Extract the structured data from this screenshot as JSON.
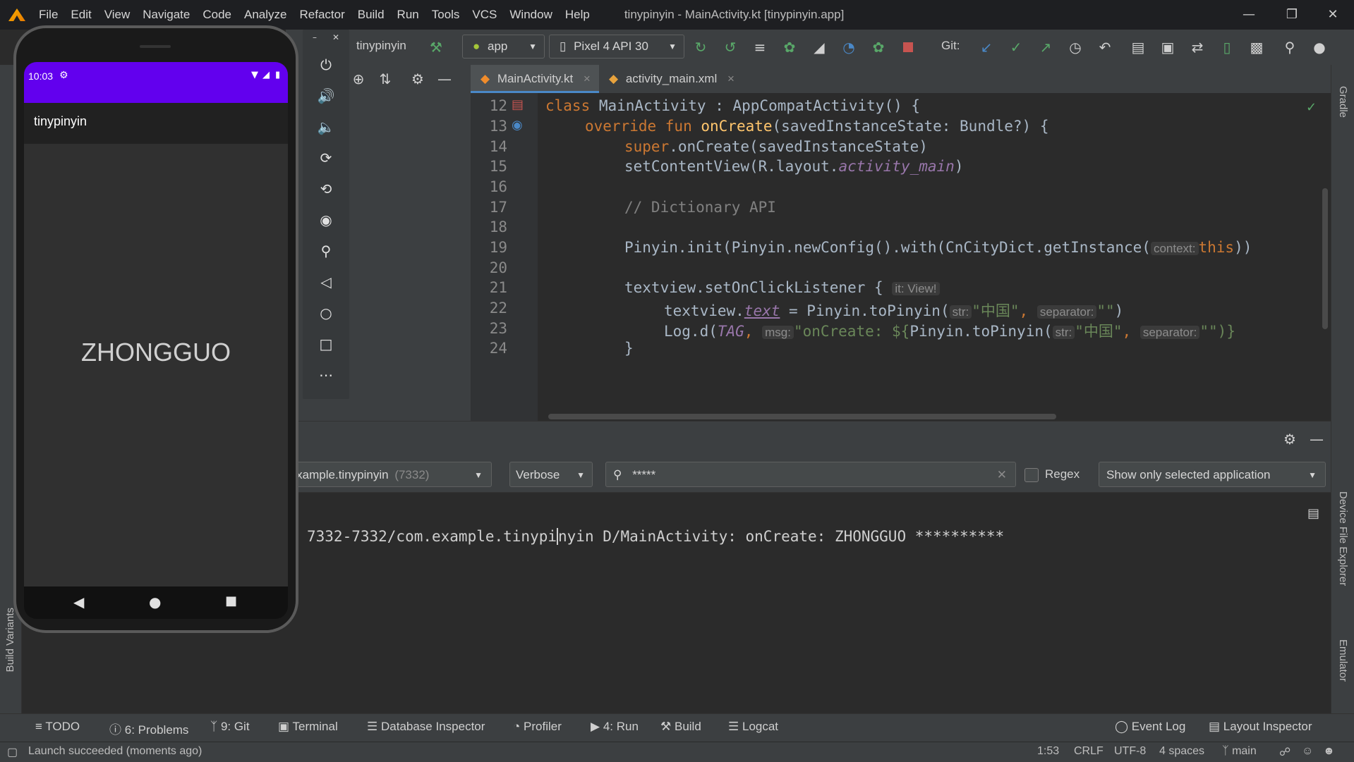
{
  "window": {
    "title": "tinypinyin - MainActivity.kt [tinypinyin.app]",
    "menus": [
      "File",
      "Edit",
      "View",
      "Navigate",
      "Code",
      "Analyze",
      "Refactor",
      "Build",
      "Run",
      "Tools",
      "VCS",
      "Window",
      "Help"
    ]
  },
  "toolbar": {
    "project": "tinypinyin",
    "run_config": "app",
    "device": "Pixel 4 API 30",
    "git_label": "Git:"
  },
  "tabs": [
    {
      "label": "MainActivity.kt",
      "active": true
    },
    {
      "label": "activity_main.xml",
      "active": false
    }
  ],
  "editor": {
    "lines": [
      {
        "n": "12"
      },
      {
        "n": "13"
      },
      {
        "n": "14"
      },
      {
        "n": "15"
      },
      {
        "n": "16"
      },
      {
        "n": "17"
      },
      {
        "n": "18"
      },
      {
        "n": "19"
      },
      {
        "n": "20"
      },
      {
        "n": "21"
      },
      {
        "n": "22"
      },
      {
        "n": "23"
      },
      {
        "n": "24"
      }
    ],
    "code": {
      "l12_kw": "class",
      "l12_rest": " MainActivity : AppCompatActivity() {",
      "l13_kw": "override fun",
      "l13_fn": "onCreate",
      "l13_rest": "(savedInstanceState: Bundle?) {",
      "l14_kw": "super",
      "l14_rest": ".onCreate(savedInstanceState)",
      "l15_a": "setContentView(R.layout.",
      "l15_it": "activity_main",
      "l15_b": ")",
      "l17_cmt": "// Dictionary API",
      "l19_a": "Pinyin.init(Pinyin.newConfig().with(CnCityDict.getInstance(",
      "l19_hint": "context:",
      "l19_kw": "this",
      "l19_b": "))",
      "l21_a": "textview.setOnClickListener {",
      "l21_hint": "it: View!",
      "l22_a": "textview.",
      "l22_prop": "text",
      "l22_b": " = Pinyin.toPinyin(",
      "l22_hint1": "str:",
      "l22_str": "\"中国\"",
      "l22_c": ",",
      "l22_hint2": "separator:",
      "l22_str2": "\"\"",
      "l22_d": ")",
      "l23_a": "Log.d(",
      "l23_it": "TAG",
      "l23_b": ",",
      "l23_hint1": "msg:",
      "l23_str": "\"onCreate: ${",
      "l23_c": "Pinyin.toPinyin(",
      "l23_hint2": "str:",
      "l23_str2": "\"中国\"",
      "l23_d": ",",
      "l23_hint3": "separator:",
      "l23_str3": "\"\")}",
      "l24": "}"
    }
  },
  "logcat": {
    "process": ".example.tinypinyin",
    "process_pid": "(7332)",
    "level": "Verbose",
    "search_value": "*****",
    "regex_label": "Regex",
    "filter": "Show only selected application",
    "line_a": "7332-7332/com.example.tinypi",
    "line_b": "nyin D/MainActivity: onCreate: ZHONGGUO **********"
  },
  "tool_tabs": {
    "todo": "TODO",
    "problems": "6: Problems",
    "git": "9: Git",
    "terminal": "Terminal",
    "db": "Database Inspector",
    "profiler": "Profiler",
    "run": "4: Run",
    "build": "Build",
    "logcat": "Logcat",
    "event_log": "Event Log",
    "layout_inspector": "Layout Inspector"
  },
  "status": {
    "message": "Launch succeeded (moments ago)",
    "position": "1:53",
    "line_sep": "CRLF",
    "encoding": "UTF-8",
    "indent": "4 spaces",
    "branch": "main"
  },
  "side_labels": {
    "gradle": "Gradle",
    "device_file_explorer": "Device File Explorer",
    "emulator": "Emulator",
    "build_variants": "Build Variants"
  },
  "phone": {
    "time": "10:03",
    "app_title": "tinypinyin",
    "main_text": "ZHONGGUO"
  },
  "colors": {
    "accent": "#6200ee",
    "brand": "#4a88c7"
  }
}
